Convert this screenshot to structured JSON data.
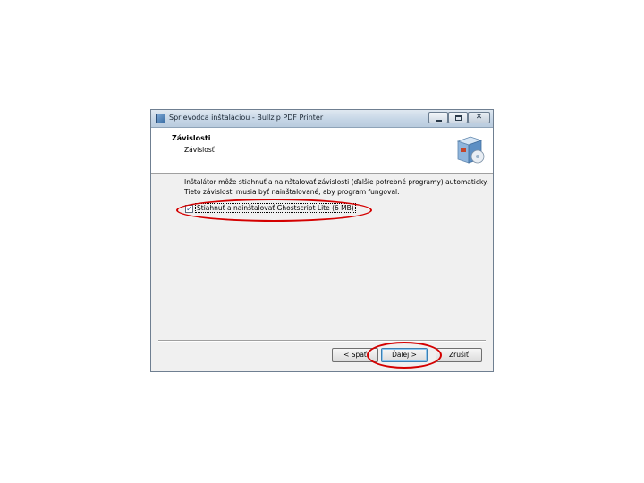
{
  "window": {
    "title": "Sprievodca inštaláciou - Bullzip PDF Printer",
    "caption_buttons": {
      "minimize_icon": "minimize-icon",
      "maximize_icon": "maximize-icon",
      "close_glyph": "✕"
    }
  },
  "header": {
    "title": "Závislosti",
    "subtitle": "Závislosť",
    "icon": "setup-box-icon"
  },
  "content": {
    "description_line1": "Inštalátor môže stiahnuť a nainštalovať závislosti (ďalšie potrebné programy) automaticky.",
    "description_line2": "Tieto závislosti musia byť nainštalované, aby program fungoval.",
    "checkbox_label": "Stiahnuť a nainštalovať Ghostscript Lite (6 MB)",
    "checkbox_checked": true,
    "checkbox_mark": "✓"
  },
  "buttons": {
    "back": "< Späť",
    "next": "Ďalej >",
    "cancel": "Zrušiť"
  },
  "annotations": {
    "highlight_color": "#d40000"
  }
}
